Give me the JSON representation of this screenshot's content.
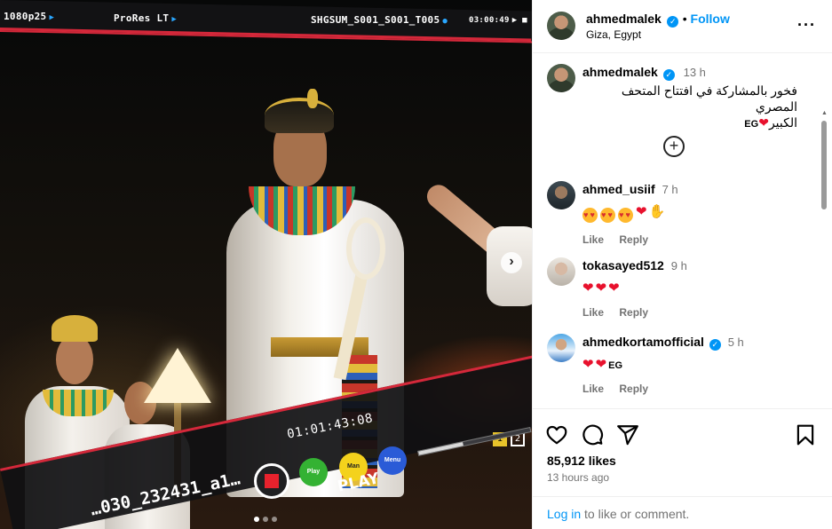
{
  "media": {
    "hud": {
      "format": "1080p25",
      "codec": "ProRes LT",
      "clip": "SHGSUM_S001_S001_T005",
      "time": "03:00:49"
    },
    "timecode": "01:01:43:08",
    "buttons": {
      "play": "Play",
      "man": "Man",
      "menu": "Menu"
    },
    "play_label": "PLAY",
    "filename": "…030_232431_a1…",
    "page_indicators": [
      "1",
      "2"
    ],
    "progress": 0.4,
    "next_icon": "chevron-right-icon",
    "carousel_dots": 3
  },
  "post": {
    "author": "ahmedmalek",
    "follow_label": "Follow",
    "location": "Giza, Egypt",
    "more_icon": "more-horizontal-icon"
  },
  "caption": {
    "username": "ahmedmalek",
    "time": "13 h",
    "text_line1": "فخور بالمشاركة في افتتاح المتحف المصري",
    "text_line2": "الكبير",
    "flag": "EG"
  },
  "comments": [
    {
      "username": "ahmed_usiif",
      "verified": false,
      "time": "7 h",
      "emojis": "😍😍😍❤️👏",
      "like": "Like",
      "reply": "Reply"
    },
    {
      "username": "tokasayed512",
      "verified": false,
      "time": "9 h",
      "emojis": "❤️❤️❤️",
      "like": "Like",
      "reply": "Reply"
    },
    {
      "username": "ahmedkortamofficial",
      "verified": true,
      "time": "5 h",
      "emojis": "❤️❤️",
      "flag": "EG",
      "like": "Like",
      "reply": "Reply"
    }
  ],
  "actions": {
    "likes": "85,912 likes",
    "time_ago": "13 hours ago",
    "login_link": "Log in",
    "login_text": " to like or comment."
  },
  "colors": {
    "accent": "#0095f6",
    "heart": "#e8112d",
    "hud_red": "#d4283a"
  }
}
